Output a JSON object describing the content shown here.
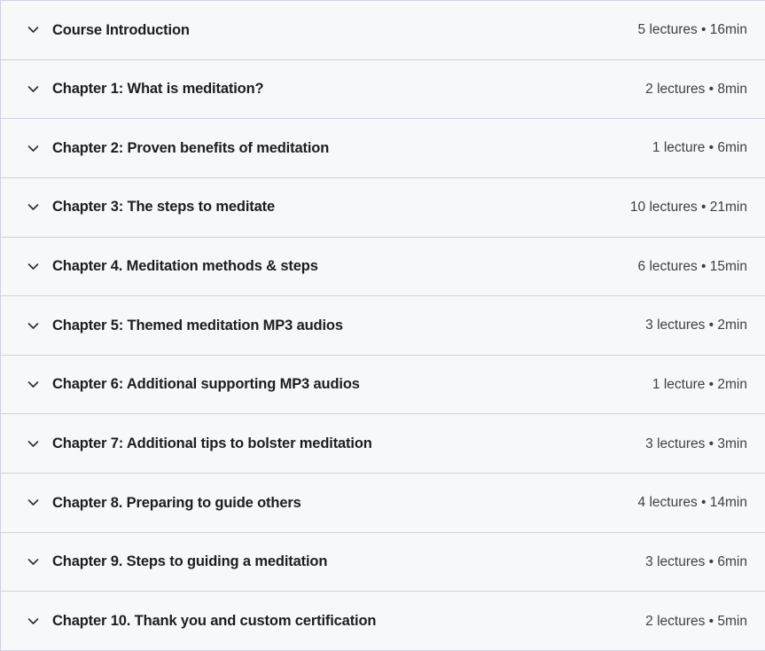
{
  "accordion": {
    "icon": "chevron-down-icon",
    "colors": {
      "row_background": "#f7f8fa",
      "divider": "#d1d2e0",
      "title_text": "#1c1d1f",
      "meta_text": "#3e4143"
    },
    "sections": [
      {
        "title": "Course Introduction",
        "meta": "5 lectures • 16min",
        "lectures": 5,
        "duration": "16min"
      },
      {
        "title": "Chapter 1: What is meditation?",
        "meta": "2 lectures • 8min",
        "lectures": 2,
        "duration": "8min"
      },
      {
        "title": "Chapter 2: Proven benefits of meditation",
        "meta": "1 lecture • 6min",
        "lectures": 1,
        "duration": "6min"
      },
      {
        "title": "Chapter 3: The steps to meditate",
        "meta": "10 lectures • 21min",
        "lectures": 10,
        "duration": "21min"
      },
      {
        "title": "Chapter 4. Meditation methods & steps",
        "meta": "6 lectures • 15min",
        "lectures": 6,
        "duration": "15min"
      },
      {
        "title": "Chapter 5: Themed meditation MP3 audios",
        "meta": "3 lectures • 2min",
        "lectures": 3,
        "duration": "2min"
      },
      {
        "title": "Chapter 6: Additional supporting MP3 audios",
        "meta": "1 lecture • 2min",
        "lectures": 1,
        "duration": "2min"
      },
      {
        "title": "Chapter 7: Additional tips to bolster meditation",
        "meta": "3 lectures • 3min",
        "lectures": 3,
        "duration": "3min"
      },
      {
        "title": "Chapter 8. Preparing to guide others",
        "meta": "4 lectures • 14min",
        "lectures": 4,
        "duration": "14min"
      },
      {
        "title": "Chapter 9. Steps to guiding a meditation",
        "meta": "3 lectures • 6min",
        "lectures": 3,
        "duration": "6min"
      },
      {
        "title": "Chapter 10. Thank you and custom certification",
        "meta": "2 lectures • 5min",
        "lectures": 2,
        "duration": "5min"
      }
    ]
  }
}
